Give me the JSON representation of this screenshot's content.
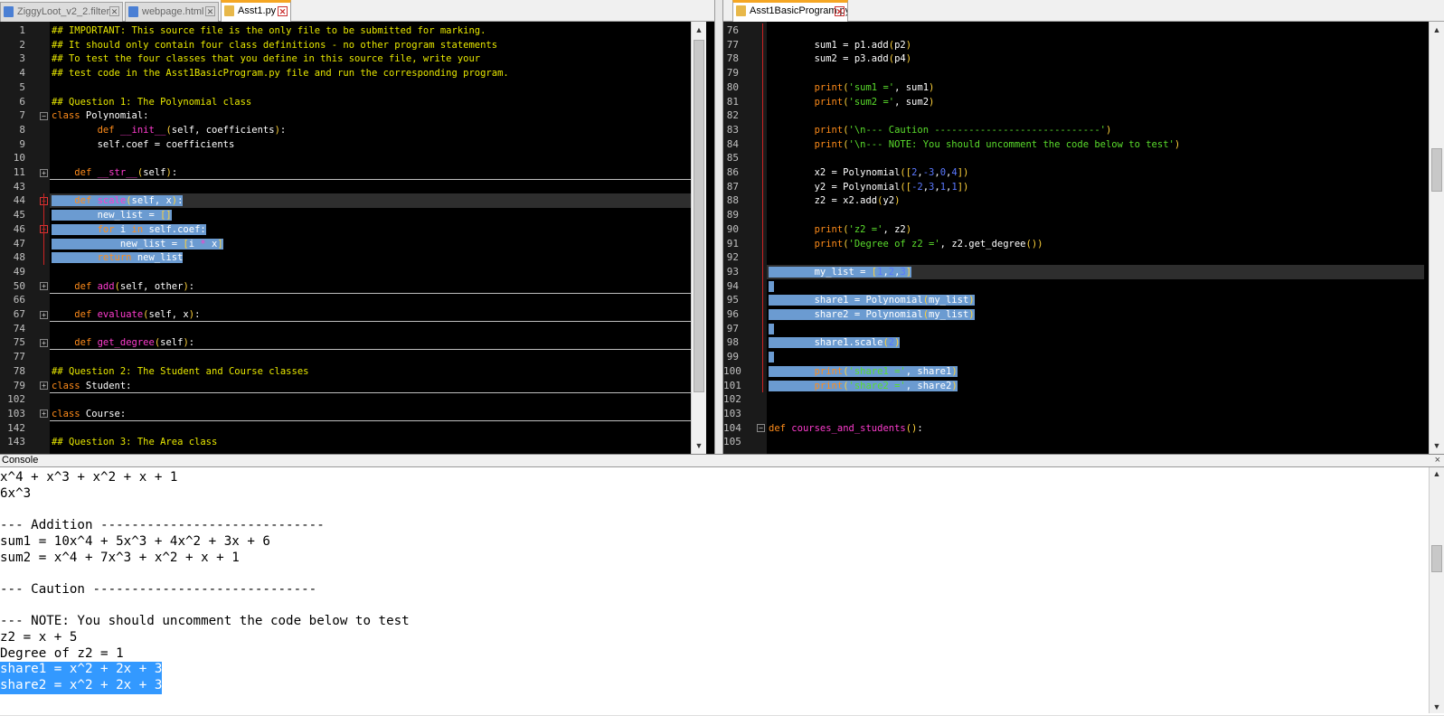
{
  "left_tabs": [
    {
      "label": "ZiggyLoot_v2_2.filter",
      "active": false
    },
    {
      "label": "webpage.html",
      "active": false
    },
    {
      "label": "Asst1.py",
      "active": true
    }
  ],
  "right_tabs": [
    {
      "label": "Asst1BasicProgram.py",
      "active": true
    }
  ],
  "left_lines": [
    {
      "n": "1",
      "s": [
        [
          "com",
          "## IMPORTANT: This source file is the only file to be submitted for marking."
        ]
      ]
    },
    {
      "n": "2",
      "s": [
        [
          "com",
          "## It should only contain four class definitions - no other program statements"
        ]
      ]
    },
    {
      "n": "3",
      "s": [
        [
          "com",
          "## To test the four classes that you define in this source file, write your"
        ]
      ]
    },
    {
      "n": "4",
      "s": [
        [
          "com",
          "## test code in the Asst1BasicProgram.py file and run the corresponding program."
        ]
      ]
    },
    {
      "n": "5",
      "s": []
    },
    {
      "n": "6",
      "s": [
        [
          "com",
          "## Question 1: The Polynomial class"
        ]
      ]
    },
    {
      "n": "7",
      "s": [
        [
          "kw",
          "class"
        ],
        [
          "txt",
          " Polynomial:"
        ]
      ]
    },
    {
      "n": "8",
      "s": [
        [
          "txt",
          "        "
        ],
        [
          "kw",
          "def"
        ],
        [
          "txt",
          " "
        ],
        [
          "fn",
          "__init__"
        ],
        [
          "par",
          "("
        ],
        [
          "txt",
          "self, coefficients"
        ],
        [
          "par",
          ")"
        ],
        [
          "txt",
          ":"
        ]
      ]
    },
    {
      "n": "9",
      "s": [
        [
          "txt",
          "        self.coef = coefficients"
        ]
      ]
    },
    {
      "n": "10",
      "s": []
    },
    {
      "n": "11",
      "s": [
        [
          "txt",
          "    "
        ],
        [
          "kw",
          "def"
        ],
        [
          "txt",
          " "
        ],
        [
          "fn",
          "__str__"
        ],
        [
          "par",
          "("
        ],
        [
          "txt",
          "self"
        ],
        [
          "par",
          ")"
        ],
        [
          "txt",
          ":"
        ]
      ]
    },
    {
      "n": "43",
      "s": []
    },
    {
      "n": "44",
      "s": [
        [
          "txt",
          "    "
        ],
        [
          "kw",
          "def"
        ],
        [
          "txt",
          " "
        ],
        [
          "fn",
          "scale"
        ],
        [
          "par",
          "("
        ],
        [
          "txt",
          "self, x"
        ],
        [
          "par",
          ")"
        ],
        [
          "txt",
          ":"
        ]
      ]
    },
    {
      "n": "45",
      "s": [
        [
          "txt",
          "        new_list = "
        ],
        [
          "par",
          "[]"
        ]
      ]
    },
    {
      "n": "46",
      "s": [
        [
          "txt",
          "        "
        ],
        [
          "kw",
          "for"
        ],
        [
          "txt",
          " i "
        ],
        [
          "kw",
          "in"
        ],
        [
          "txt",
          " self.coef:"
        ]
      ]
    },
    {
      "n": "47",
      "s": [
        [
          "txt",
          "            new_list = "
        ],
        [
          "par",
          "["
        ],
        [
          "txt",
          "i "
        ],
        [
          "fn",
          "*"
        ],
        [
          "txt",
          " x"
        ],
        [
          "par",
          "]"
        ]
      ]
    },
    {
      "n": "48",
      "s": [
        [
          "txt",
          "        "
        ],
        [
          "kw",
          "return"
        ],
        [
          "txt",
          " new_list"
        ]
      ]
    },
    {
      "n": "49",
      "s": []
    },
    {
      "n": "50",
      "s": [
        [
          "txt",
          "    "
        ],
        [
          "kw",
          "def"
        ],
        [
          "txt",
          " "
        ],
        [
          "fn",
          "add"
        ],
        [
          "par",
          "("
        ],
        [
          "txt",
          "self, other"
        ],
        [
          "par",
          ")"
        ],
        [
          "txt",
          ":"
        ]
      ]
    },
    {
      "n": "66",
      "s": []
    },
    {
      "n": "67",
      "s": [
        [
          "txt",
          "    "
        ],
        [
          "kw",
          "def"
        ],
        [
          "txt",
          " "
        ],
        [
          "fn",
          "evaluate"
        ],
        [
          "par",
          "("
        ],
        [
          "txt",
          "self, x"
        ],
        [
          "par",
          ")"
        ],
        [
          "txt",
          ":"
        ]
      ]
    },
    {
      "n": "74",
      "s": []
    },
    {
      "n": "75",
      "s": [
        [
          "txt",
          "    "
        ],
        [
          "kw",
          "def"
        ],
        [
          "txt",
          " "
        ],
        [
          "fn",
          "get_degree"
        ],
        [
          "par",
          "("
        ],
        [
          "txt",
          "self"
        ],
        [
          "par",
          ")"
        ],
        [
          "txt",
          ":"
        ]
      ]
    },
    {
      "n": "77",
      "s": []
    },
    {
      "n": "78",
      "s": [
        [
          "com",
          "## Question 2: The Student and Course classes"
        ]
      ]
    },
    {
      "n": "79",
      "s": [
        [
          "kw",
          "class"
        ],
        [
          "txt",
          " Student:"
        ]
      ]
    },
    {
      "n": "102",
      "s": []
    },
    {
      "n": "103",
      "s": [
        [
          "kw",
          "class"
        ],
        [
          "txt",
          " Course:"
        ]
      ]
    },
    {
      "n": "142",
      "s": []
    },
    {
      "n": "143",
      "s": [
        [
          "com",
          "## Question 3: The Area class"
        ]
      ]
    }
  ],
  "right_lines": [
    {
      "n": "76",
      "s": []
    },
    {
      "n": "77",
      "s": [
        [
          "txt",
          "        sum1 = p1.add"
        ],
        [
          "par",
          "("
        ],
        [
          "txt",
          "p2"
        ],
        [
          "par",
          ")"
        ]
      ]
    },
    {
      "n": "78",
      "s": [
        [
          "txt",
          "        sum2 = p3.add"
        ],
        [
          "par",
          "("
        ],
        [
          "txt",
          "p4"
        ],
        [
          "par",
          ")"
        ]
      ]
    },
    {
      "n": "79",
      "s": []
    },
    {
      "n": "80",
      "s": [
        [
          "txt",
          "        "
        ],
        [
          "kw",
          "print"
        ],
        [
          "par",
          "("
        ],
        [
          "str",
          "'sum1 ='"
        ],
        [
          "txt",
          ", sum1"
        ],
        [
          "par",
          ")"
        ]
      ]
    },
    {
      "n": "81",
      "s": [
        [
          "txt",
          "        "
        ],
        [
          "kw",
          "print"
        ],
        [
          "par",
          "("
        ],
        [
          "str",
          "'sum2 ='"
        ],
        [
          "txt",
          ", sum2"
        ],
        [
          "par",
          ")"
        ]
      ]
    },
    {
      "n": "82",
      "s": []
    },
    {
      "n": "83",
      "s": [
        [
          "txt",
          "        "
        ],
        [
          "kw",
          "print"
        ],
        [
          "par",
          "("
        ],
        [
          "str",
          "'\\n--- Caution -----------------------------'"
        ],
        [
          "par",
          ")"
        ]
      ]
    },
    {
      "n": "84",
      "s": [
        [
          "txt",
          "        "
        ],
        [
          "kw",
          "print"
        ],
        [
          "par",
          "("
        ],
        [
          "str",
          "'\\n--- NOTE: You should uncomment the code below to test'"
        ],
        [
          "par",
          ")"
        ]
      ]
    },
    {
      "n": "85",
      "s": []
    },
    {
      "n": "86",
      "s": [
        [
          "txt",
          "        x2 = Polynomial"
        ],
        [
          "par",
          "(["
        ],
        [
          "num",
          "2"
        ],
        [
          "txt",
          ","
        ],
        [
          "num",
          "-3"
        ],
        [
          "txt",
          ","
        ],
        [
          "num",
          "0"
        ],
        [
          "txt",
          ","
        ],
        [
          "num",
          "4"
        ],
        [
          "par",
          "])"
        ]
      ]
    },
    {
      "n": "87",
      "s": [
        [
          "txt",
          "        y2 = Polynomial"
        ],
        [
          "par",
          "(["
        ],
        [
          "num",
          "-2"
        ],
        [
          "txt",
          ","
        ],
        [
          "num",
          "3"
        ],
        [
          "txt",
          ","
        ],
        [
          "num",
          "1"
        ],
        [
          "txt",
          ","
        ],
        [
          "num",
          "1"
        ],
        [
          "par",
          "])"
        ]
      ]
    },
    {
      "n": "88",
      "s": [
        [
          "txt",
          "        z2 = x2.add"
        ],
        [
          "par",
          "("
        ],
        [
          "txt",
          "y2"
        ],
        [
          "par",
          ")"
        ]
      ]
    },
    {
      "n": "89",
      "s": []
    },
    {
      "n": "90",
      "s": [
        [
          "txt",
          "        "
        ],
        [
          "kw",
          "print"
        ],
        [
          "par",
          "("
        ],
        [
          "str",
          "'z2 ='"
        ],
        [
          "txt",
          ", z2"
        ],
        [
          "par",
          ")"
        ]
      ]
    },
    {
      "n": "91",
      "s": [
        [
          "txt",
          "        "
        ],
        [
          "kw",
          "print"
        ],
        [
          "par",
          "("
        ],
        [
          "str",
          "'Degree of z2 ='"
        ],
        [
          "txt",
          ", z2.get_degree"
        ],
        [
          "par",
          "())"
        ]
      ]
    },
    {
      "n": "92",
      "s": []
    },
    {
      "n": "93",
      "s": [
        [
          "txt",
          "        my_list = "
        ],
        [
          "par",
          "["
        ],
        [
          "num",
          "1"
        ],
        [
          "txt",
          ","
        ],
        [
          "num",
          "2"
        ],
        [
          "txt",
          ","
        ],
        [
          "num",
          "3"
        ],
        [
          "par",
          "]"
        ]
      ]
    },
    {
      "n": "94",
      "s": []
    },
    {
      "n": "95",
      "s": [
        [
          "txt",
          "        share1 = Polynomial"
        ],
        [
          "par",
          "("
        ],
        [
          "txt",
          "my_list"
        ],
        [
          "par",
          ")"
        ]
      ]
    },
    {
      "n": "96",
      "s": [
        [
          "txt",
          "        share2 = Polynomial"
        ],
        [
          "par",
          "("
        ],
        [
          "txt",
          "my_list"
        ],
        [
          "par",
          ")"
        ]
      ]
    },
    {
      "n": "97",
      "s": []
    },
    {
      "n": "98",
      "s": [
        [
          "txt",
          "        share1.scale"
        ],
        [
          "par",
          "("
        ],
        [
          "num",
          "2"
        ],
        [
          "par",
          ")"
        ]
      ]
    },
    {
      "n": "99",
      "s": []
    },
    {
      "n": "100",
      "s": [
        [
          "txt",
          "        "
        ],
        [
          "kw",
          "print"
        ],
        [
          "par",
          "("
        ],
        [
          "str",
          "'share1 ='"
        ],
        [
          "txt",
          ", share1"
        ],
        [
          "par",
          ")"
        ]
      ]
    },
    {
      "n": "101",
      "s": [
        [
          "txt",
          "        "
        ],
        [
          "kw",
          "print"
        ],
        [
          "par",
          "("
        ],
        [
          "str",
          "'share2 ='"
        ],
        [
          "txt",
          ", share2"
        ],
        [
          "par",
          ")"
        ]
      ]
    },
    {
      "n": "102",
      "s": []
    },
    {
      "n": "103",
      "s": []
    },
    {
      "n": "104",
      "s": [
        [
          "kw",
          "def"
        ],
        [
          "txt",
          " "
        ],
        [
          "fn",
          "courses_and_students"
        ],
        [
          "par",
          "()"
        ],
        [
          "txt",
          ":"
        ]
      ]
    },
    {
      "n": "105",
      "s": []
    }
  ],
  "console": {
    "title": "Console",
    "close_glyph": "×",
    "lines": [
      "x^4 + x^3 + x^2 + x + 1",
      "6x^3",
      "",
      "--- Addition -----------------------------",
      "sum1 = 10x^4 + 5x^3 + 4x^2 + 3x + 6",
      "sum2 = x^4 + 7x^3 + x^2 + x + 1",
      "",
      "--- Caution -----------------------------",
      "",
      "--- NOTE: You should uncomment the code below to test",
      "z2 = x + 5",
      "Degree of z2 = 1",
      "share1 = x^2 + 2x + 3",
      "share2 = x^2 + 2x + 3"
    ]
  },
  "colors": {
    "comment": "#e8e800",
    "keyword": "#ff8c1a",
    "function": "#ff3ccf",
    "string": "#5adc2c",
    "number": "#5a78ff",
    "paren": "#ffd23a",
    "selection": "#6b9bd1",
    "console_selection": "#3399ff"
  }
}
